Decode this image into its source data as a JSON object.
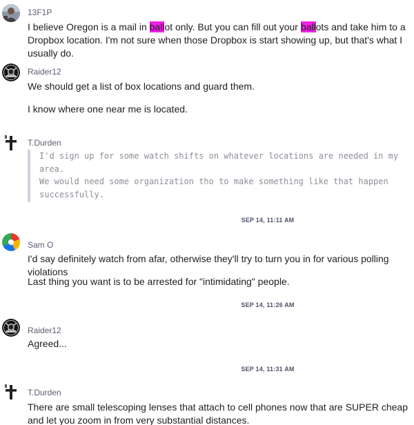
{
  "messages": [
    {
      "author": "13F1P",
      "avatar": "photo-avatar",
      "text": {
        "p1_a": "I believe Oregon is a mail in ",
        "p1_hl1": "ball",
        "p1_b": "ot only. But you can fill out your ",
        "p1_hl2": "ball",
        "p1_c": "ots and take him to a Dropbox location. I'm not sure when those Dropbox is start showing up, but that's what I usually do."
      }
    },
    {
      "author": "Raider12",
      "avatar": "raiders-logo-avatar",
      "paragraphs": [
        "We should get a list of box locations and guard them.",
        "I know where one near me is located."
      ]
    },
    {
      "author": "T.Durden",
      "avatar": "cross-avatar",
      "quote": [
        "I'd sign up for some watch shifts on whatever locations are needed in my area.",
        "We would need some organization tho to make something like that happen successfully."
      ]
    },
    {
      "timestamp": "SEP 14, 11:11 AM",
      "author": "Sam O",
      "avatar": "colorful-pinwheel-avatar",
      "paragraphs": [
        "I'd say definitely watch from afar, otherwise they'll try to turn you in for various polling violations",
        "Last thing you want is to be arrested for \"intimidating\" people."
      ]
    },
    {
      "timestamp": "SEP 14, 11:26 AM",
      "author": "Raider12",
      "avatar": "raiders-logo-avatar",
      "paragraphs": [
        "Agreed..."
      ]
    },
    {
      "timestamp": "SEP 14, 11:31 AM",
      "author": "T.Durden",
      "avatar": "cross-avatar",
      "paragraphs": [
        "There are small telescoping lenses that attach to cell phones now that are SUPER cheap and let you zoom in from very substantial distances."
      ]
    }
  ],
  "colors": {
    "highlight": "#f21fe7",
    "author": "#5a5f70",
    "timestamp": "#4c5266",
    "quote_text": "#8b8f98",
    "quote_bar": "#cfd3da"
  }
}
